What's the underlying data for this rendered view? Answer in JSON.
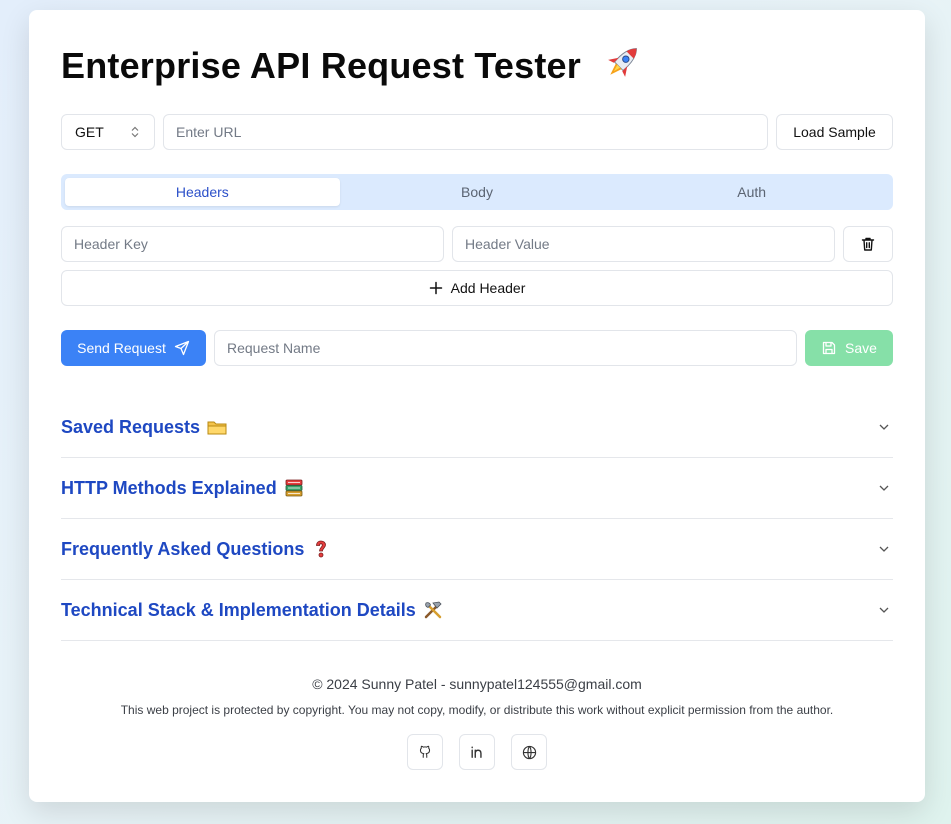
{
  "title": "Enterprise API Request Tester",
  "icons": {
    "title": "rocket-icon",
    "method_select": "chevron-up-down-icon",
    "delete_header": "trash-icon",
    "add_header": "plus-icon",
    "send": "send-icon",
    "save": "save-icon",
    "accordion": "chevron-down-icon",
    "social": [
      "github-icon",
      "linkedin-icon",
      "globe-icon"
    ]
  },
  "request": {
    "method": "GET",
    "url_placeholder": "Enter URL",
    "url_value": "",
    "load_sample_label": "Load Sample"
  },
  "tabs": [
    {
      "label": "Headers",
      "active": true
    },
    {
      "label": "Body",
      "active": false
    },
    {
      "label": "Auth",
      "active": false
    }
  ],
  "headers": {
    "key_placeholder": "Header Key",
    "value_placeholder": "Header Value",
    "add_label": "Add Header"
  },
  "actions": {
    "send_label": "Send Request",
    "name_placeholder": "Request Name",
    "save_label": "Save"
  },
  "accordions": [
    {
      "title": "Saved Requests",
      "icon": "folder-icon"
    },
    {
      "title": "HTTP Methods Explained",
      "icon": "books-icon"
    },
    {
      "title": "Frequently Asked Questions",
      "icon": "question-icon"
    },
    {
      "title": "Technical Stack & Implementation Details",
      "icon": "tools-icon"
    }
  ],
  "footer": {
    "copyright": "© 2024 Sunny Patel - sunnypatel124555@gmail.com",
    "notice": "This web project is protected by copyright. You may not copy, modify, or distribute this work without explicit permission from the author."
  },
  "colors": {
    "accent": "#3b82f6",
    "accordion_title": "#1e48c2",
    "tabs_bg": "#dbeafe",
    "save_disabled": "#86e0a8"
  }
}
